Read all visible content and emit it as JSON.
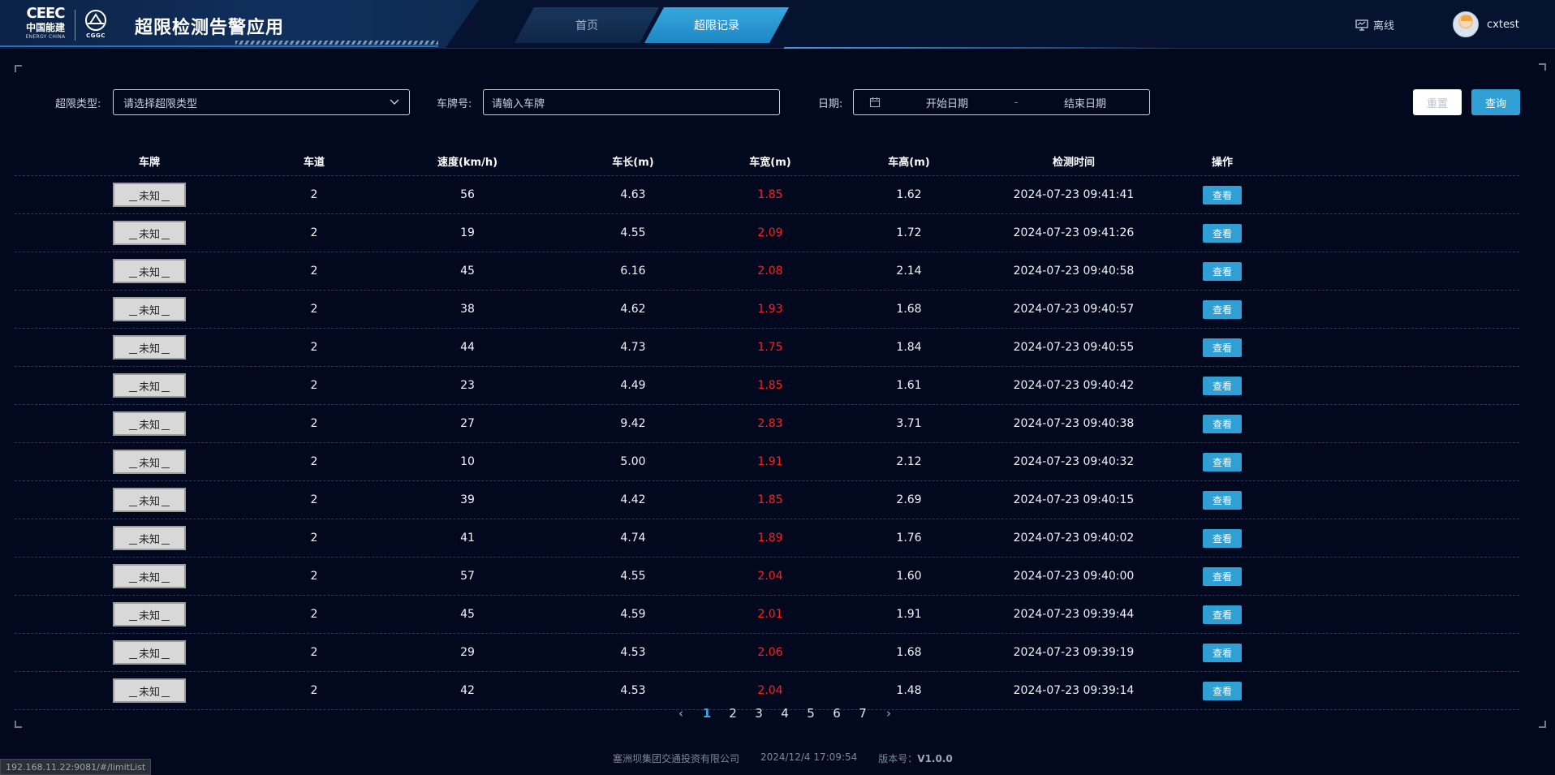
{
  "header": {
    "logo_mark": "CEEC",
    "logo_cn": "中国能建",
    "logo_en": "ENERGY CHINA",
    "logo2_sub": "CGGC",
    "title": "超限检测告警应用",
    "nav": [
      {
        "label": "首页",
        "active": false
      },
      {
        "label": "超限记录",
        "active": true
      }
    ],
    "status_label": "离线",
    "username": "cxtest"
  },
  "filters": {
    "type_label": "超限类型:",
    "type_placeholder": "请选择超限类型",
    "plate_label": "车牌号:",
    "plate_placeholder": "请输入车牌",
    "date_label": "日期:",
    "date_start_placeholder": "开始日期",
    "date_separator": "-",
    "date_end_placeholder": "结束日期",
    "reset_label": "重置",
    "query_label": "查询"
  },
  "table": {
    "columns": [
      "车牌",
      "车道",
      "速度(km/h)",
      "车长(m)",
      "车宽(m)",
      "车高(m)",
      "检测时间",
      "操作"
    ],
    "action_label": "查看",
    "rows": [
      {
        "plate": "未知",
        "lane": "2",
        "speed": "56",
        "length": "4.63",
        "width": "1.85",
        "height": "1.62",
        "time": "2024-07-23 09:41:41"
      },
      {
        "plate": "未知",
        "lane": "2",
        "speed": "19",
        "length": "4.55",
        "width": "2.09",
        "height": "1.72",
        "time": "2024-07-23 09:41:26"
      },
      {
        "plate": "未知",
        "lane": "2",
        "speed": "45",
        "length": "6.16",
        "width": "2.08",
        "height": "2.14",
        "time": "2024-07-23 09:40:58"
      },
      {
        "plate": "未知",
        "lane": "2",
        "speed": "38",
        "length": "4.62",
        "width": "1.93",
        "height": "1.68",
        "time": "2024-07-23 09:40:57"
      },
      {
        "plate": "未知",
        "lane": "2",
        "speed": "44",
        "length": "4.73",
        "width": "1.75",
        "height": "1.84",
        "time": "2024-07-23 09:40:55"
      },
      {
        "plate": "未知",
        "lane": "2",
        "speed": "23",
        "length": "4.49",
        "width": "1.85",
        "height": "1.61",
        "time": "2024-07-23 09:40:42"
      },
      {
        "plate": "未知",
        "lane": "2",
        "speed": "27",
        "length": "9.42",
        "width": "2.83",
        "height": "3.71",
        "time": "2024-07-23 09:40:38"
      },
      {
        "plate": "未知",
        "lane": "2",
        "speed": "10",
        "length": "5.00",
        "width": "1.91",
        "height": "2.12",
        "time": "2024-07-23 09:40:32"
      },
      {
        "plate": "未知",
        "lane": "2",
        "speed": "39",
        "length": "4.42",
        "width": "1.85",
        "height": "2.69",
        "time": "2024-07-23 09:40:15"
      },
      {
        "plate": "未知",
        "lane": "2",
        "speed": "41",
        "length": "4.74",
        "width": "1.89",
        "height": "1.76",
        "time": "2024-07-23 09:40:02"
      },
      {
        "plate": "未知",
        "lane": "2",
        "speed": "57",
        "length": "4.55",
        "width": "2.04",
        "height": "1.60",
        "time": "2024-07-23 09:40:00"
      },
      {
        "plate": "未知",
        "lane": "2",
        "speed": "45",
        "length": "4.59",
        "width": "2.01",
        "height": "1.91",
        "time": "2024-07-23 09:39:44"
      },
      {
        "plate": "未知",
        "lane": "2",
        "speed": "29",
        "length": "4.53",
        "width": "2.06",
        "height": "1.68",
        "time": "2024-07-23 09:39:19"
      },
      {
        "plate": "未知",
        "lane": "2",
        "speed": "42",
        "length": "4.53",
        "width": "2.04",
        "height": "1.48",
        "time": "2024-07-23 09:39:14"
      }
    ]
  },
  "pagination": {
    "prev": "‹",
    "pages": [
      "1",
      "2",
      "3",
      "4",
      "5",
      "6",
      "7"
    ],
    "current": "1",
    "next": "›"
  },
  "footer": {
    "company": "塞洲坝集团交通投资有限公司",
    "datetime": "2024/12/4 17:09:54",
    "version_label": "版本号：",
    "version": "V1.0.0"
  },
  "status_url": "192.168.11.22:9081/#/limitList",
  "colors": {
    "background": "#02091f",
    "accent": "#2f9fd4",
    "alert": "#ff1f1f"
  }
}
